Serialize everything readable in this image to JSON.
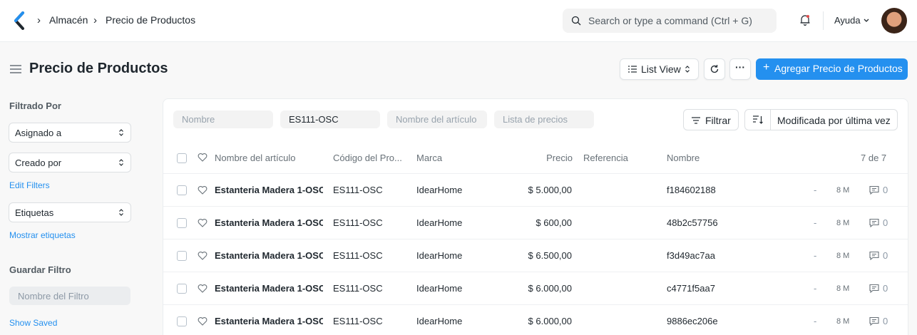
{
  "breadcrumb": [
    "Almacén",
    "Precio de Productos"
  ],
  "search": {
    "placeholder": "Search or type a command (Ctrl + G)"
  },
  "navbar": {
    "help_label": "Ayuda"
  },
  "page": {
    "title": "Precio de Productos"
  },
  "toolbar": {
    "view_label": "List View",
    "more_label": "···",
    "add_label": "Agregar Precio de Productos"
  },
  "sidebar": {
    "filtered_by": "Filtrado Por",
    "assigned_to": "Asignado a",
    "created_by": "Creado por",
    "edit_filters": "Edit Filters",
    "tags": "Etiquetas",
    "show_tags": "Mostrar etiquetas",
    "save_filter": "Guardar Filtro",
    "filter_name_placeholder": "Nombre del Filtro",
    "show_saved": "Show Saved"
  },
  "filters": {
    "name_placeholder": "Nombre",
    "item_code_value": "ES111-OSC",
    "item_name_placeholder": "Nombre del artículo",
    "price_list_placeholder": "Lista de precios",
    "filter_label": "Filtrar",
    "sort_label": "Modificada por última vez"
  },
  "table": {
    "columns": [
      "Nombre del artículo",
      "Código del Pro...",
      "Marca",
      "Precio",
      "Referencia",
      "Nombre"
    ],
    "count": "7 de 7",
    "rows": [
      {
        "item_name": "Estanteria Madera 1-OSC",
        "item_code": "ES111-OSC",
        "brand": "IdearHome",
        "price": "$ 5.000,00",
        "reference": "",
        "name": "f184602188",
        "dash": "-",
        "modified": "8 M",
        "comments": "0"
      },
      {
        "item_name": "Estanteria Madera 1-OSC",
        "item_code": "ES111-OSC",
        "brand": "IdearHome",
        "price": "$ 600,00",
        "reference": "",
        "name": "48b2c57756",
        "dash": "-",
        "modified": "8 M",
        "comments": "0"
      },
      {
        "item_name": "Estanteria Madera 1-OSC",
        "item_code": "ES111-OSC",
        "brand": "IdearHome",
        "price": "$ 6.500,00",
        "reference": "",
        "name": "f3d49ac7aa",
        "dash": "-",
        "modified": "8 M",
        "comments": "0"
      },
      {
        "item_name": "Estanteria Madera 1-OSC",
        "item_code": "ES111-OSC",
        "brand": "IdearHome",
        "price": "$ 6.000,00",
        "reference": "",
        "name": "c4771f5aa7",
        "dash": "-",
        "modified": "8 M",
        "comments": "0"
      },
      {
        "item_name": "Estanteria Madera 1-OSC",
        "item_code": "ES111-OSC",
        "brand": "IdearHome",
        "price": "$ 6.000,00",
        "reference": "",
        "name": "9886ec206e",
        "dash": "-",
        "modified": "8 M",
        "comments": "0"
      }
    ]
  },
  "colors": {
    "primary": "#2490ef",
    "text": "#1f272e",
    "muted": "#687178"
  }
}
